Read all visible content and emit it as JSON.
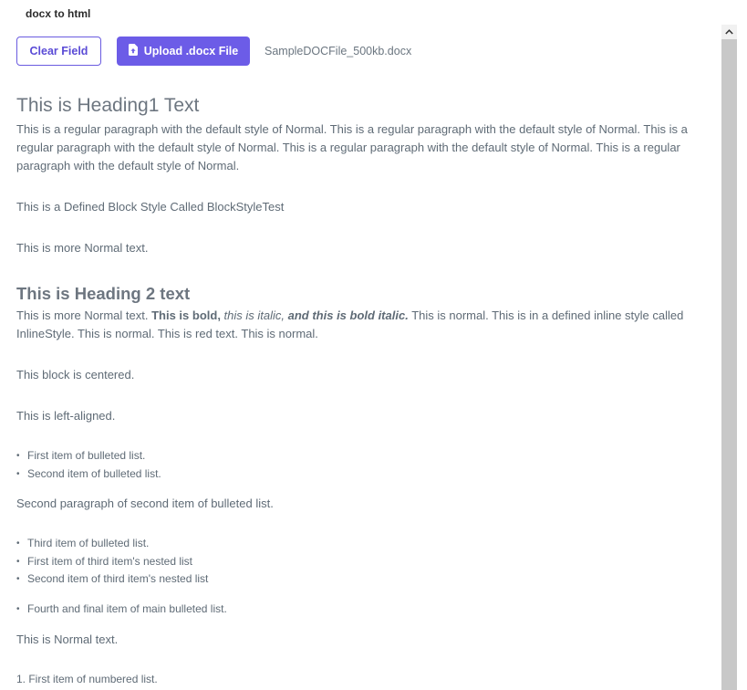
{
  "app": {
    "title": "docx to html"
  },
  "toolbar": {
    "clear_label": "Clear Field",
    "upload_label": "Upload .docx File",
    "upload_icon": "file-upload-icon",
    "file_name": "SampleDOCFile_500kb.docx"
  },
  "document": {
    "heading1": "This is Heading1 Text",
    "para1": "This is a regular paragraph with the default style of Normal. This is a regular paragraph with the default style of Normal. This is a regular paragraph with the default style of Normal. This is a regular paragraph with the default style of Normal. This is a regular paragraph with the default style of Normal.",
    "block_style": "This is a Defined Block Style Called BlockStyleTest",
    "more_normal": "This is more Normal text.",
    "heading2": "This is Heading 2 text",
    "mixed": {
      "normal1": "This is more Normal text. ",
      "bold": "This is bold, ",
      "italic": "this is italic, ",
      "bold_italic": "and this is bold italic.",
      "normal2": " This is normal. This is in a defined inline style called InlineStyle. This is normal. This is red text. This is normal."
    },
    "centered": "This block is centered.",
    "left_aligned": "This is left-aligned.",
    "bullets1": [
      "First item of bulleted list.",
      "Second item of bulleted list."
    ],
    "second_para": "Second paragraph of second item of bulleted list.",
    "bullets2": [
      "Third item of bulleted list.",
      "First item of third item's nested list",
      "Second item of third item's nested list"
    ],
    "bullets3": [
      "Fourth and final item of main bulleted list."
    ],
    "normal_text": "This is Normal text.",
    "numbered": [
      "1. First item of numbered list."
    ]
  },
  "colors": {
    "accent": "#6c5ce7",
    "text": "#5f6b76",
    "scrollbar": "#c8c8c8"
  }
}
